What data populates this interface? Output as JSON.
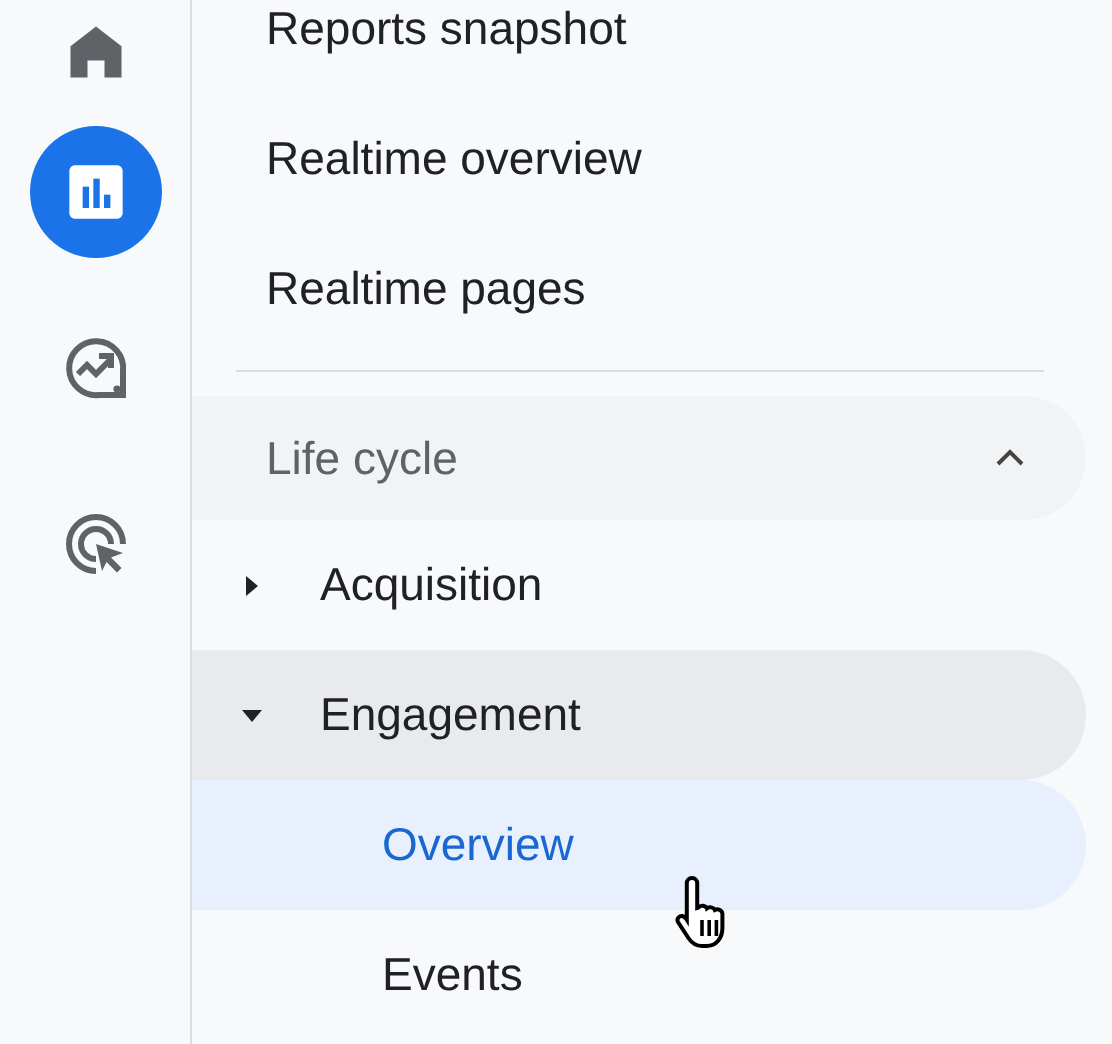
{
  "rail": {
    "items": [
      {
        "kind": "home",
        "selected": false
      },
      {
        "kind": "reports",
        "selected": true
      },
      {
        "kind": "explore",
        "selected": false
      },
      {
        "kind": "advertising",
        "selected": false
      }
    ]
  },
  "nav": {
    "items": [
      {
        "label": "Reports snapshot"
      },
      {
        "label": "Realtime overview"
      },
      {
        "label": "Realtime pages"
      }
    ],
    "section": {
      "label": "Life cycle",
      "expanded": true,
      "children": [
        {
          "label": "Acquisition",
          "expanded": false
        },
        {
          "label": "Engagement",
          "expanded": true,
          "children": [
            {
              "label": "Overview",
              "selected": true
            },
            {
              "label": "Events",
              "selected": false
            }
          ]
        }
      ]
    }
  }
}
